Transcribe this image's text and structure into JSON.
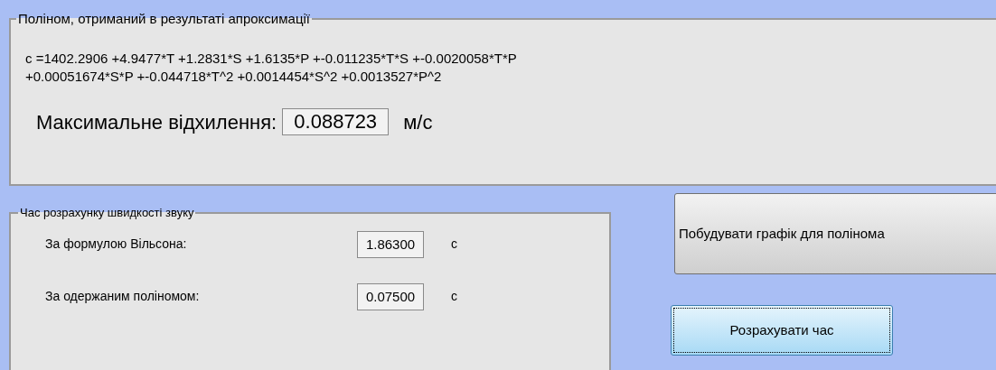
{
  "polynomial_group": {
    "title": "Поліном, отриманий в результаті апроксимації",
    "formula_lines": [
      "c =1402.2906 +4.9477*T +1.2831*S +1.6135*P +-0.011235*T*S +-0.0020058*T*P",
      "+0.00051674*S*P +-0.044718*T^2 +0.0014454*S^2 +0.0013527*P^2"
    ],
    "max_deviation": {
      "label": "Максимальне відхилення:",
      "value": "0.088723",
      "unit": "м/с"
    }
  },
  "timing_group": {
    "title": "Час розрахунку швидкості звуку",
    "rows": [
      {
        "label": "За формулою Вільсона:",
        "value": "1.86300",
        "unit": "с"
      },
      {
        "label": "За одержаним поліномом:",
        "value": "0.07500",
        "unit": "с"
      }
    ]
  },
  "buttons": [
    {
      "label": "Побудувати графік для полінома",
      "focused": false
    },
    {
      "label": "Розрахувати час",
      "focused": true
    }
  ]
}
